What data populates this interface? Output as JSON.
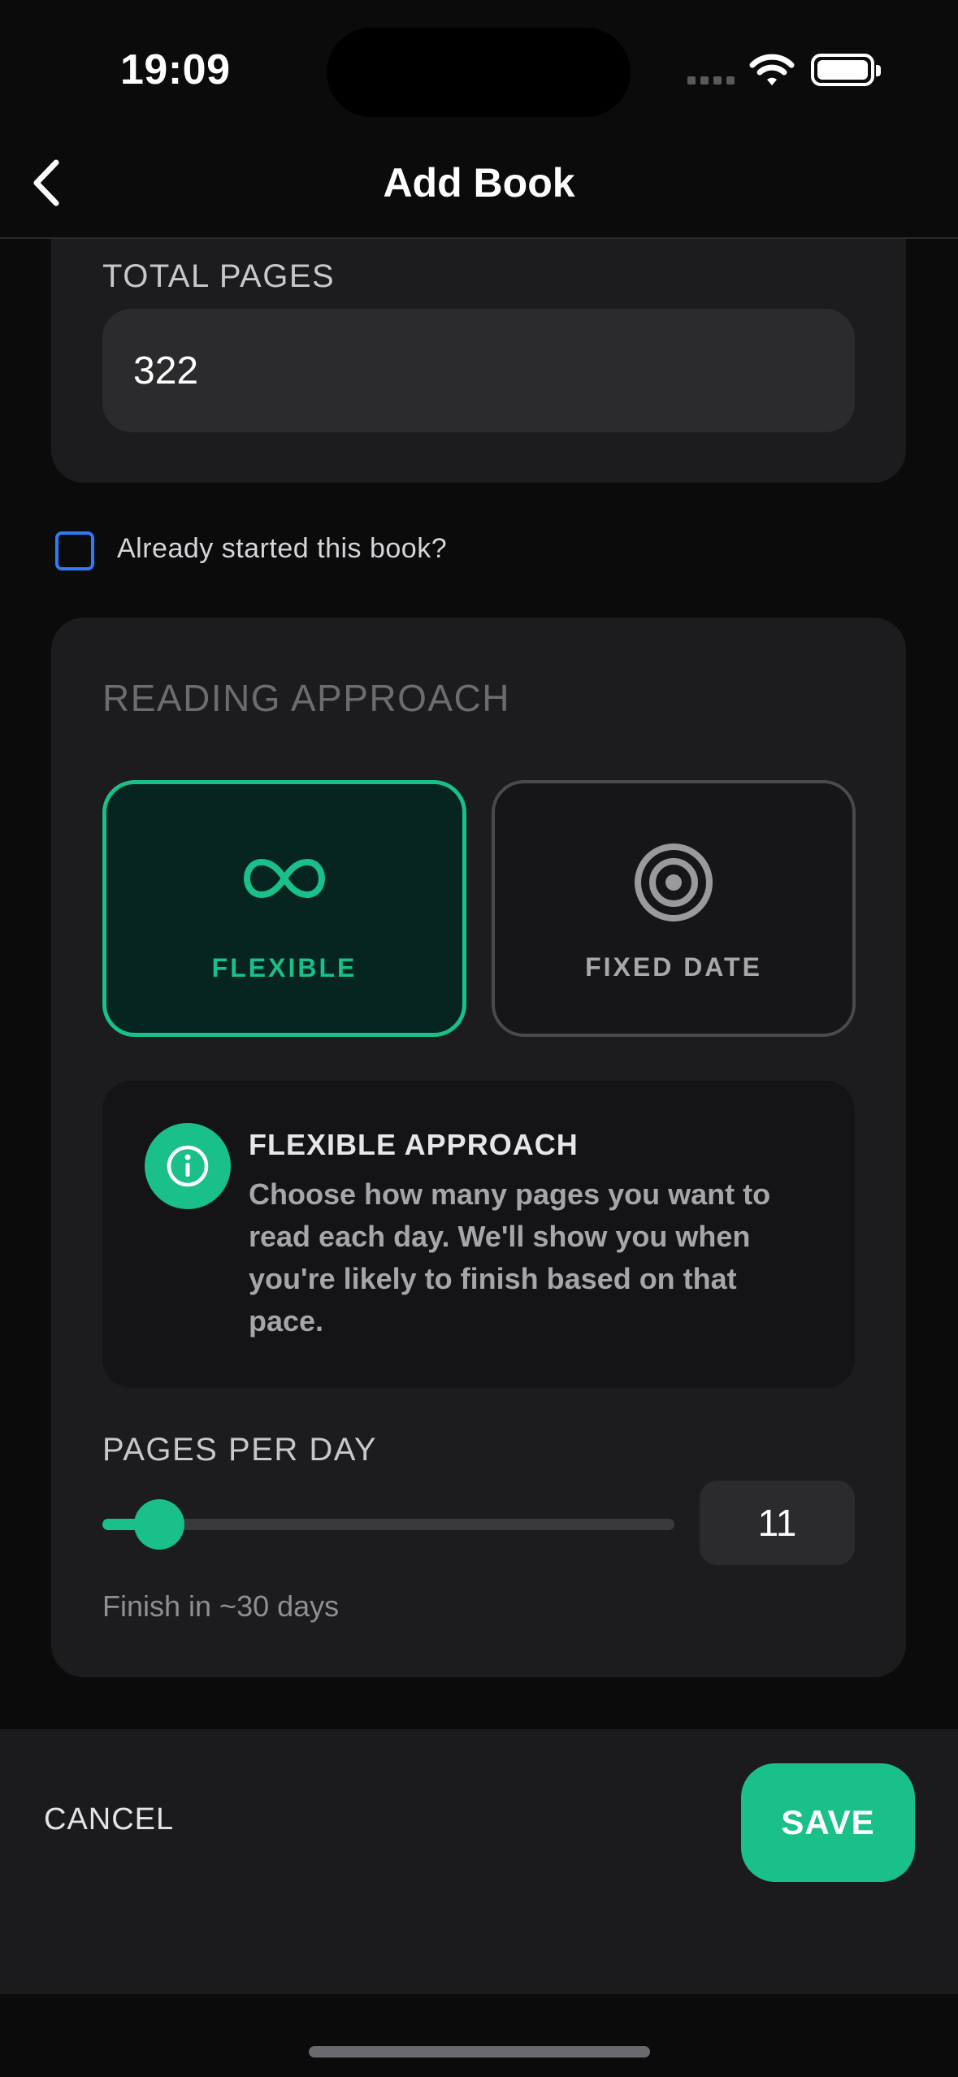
{
  "status_bar": {
    "time": "19:09"
  },
  "nav": {
    "title": "Add Book"
  },
  "total_pages": {
    "label": "TOTAL PAGES",
    "value": "322"
  },
  "already_started": {
    "label": "Already started this book?",
    "checked": false
  },
  "reading_approach": {
    "title": "READING APPROACH",
    "options": [
      {
        "label": "FLEXIBLE",
        "icon": "infinity-icon",
        "selected": true
      },
      {
        "label": "FIXED DATE",
        "icon": "target-icon",
        "selected": false
      }
    ],
    "info": {
      "icon": "info-icon",
      "title": "FLEXIBLE APPROACH",
      "body": "Choose how many pages you want to read each day. We'll show you when you're likely to finish based on that pace."
    }
  },
  "pages_per_day": {
    "label": "PAGES PER DAY",
    "value": "11",
    "slider_fraction": 0.1,
    "finish_text": "Finish in ~30 days"
  },
  "actions": {
    "cancel_label": "CANCEL",
    "save_label": "SAVE"
  },
  "colors": {
    "accent": "#19c089",
    "checkbox_border": "#2f7cf6",
    "background": "#0b0b0c",
    "card": "#1c1c1e"
  }
}
